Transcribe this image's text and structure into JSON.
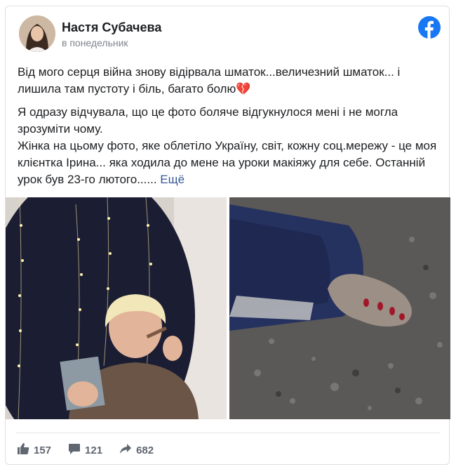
{
  "post": {
    "author": "Настя Субачева",
    "timestamp": "в понедельник",
    "paragraph1": "Від мого серця війна знову відірвала шматок...величезний шматок... і лишила там пустоту і біль, багато болю💔",
    "paragraph2_line1": "Я одразу відчувала, що це фото боляче відгукнулося мені і не могла зрозуміти чому.",
    "paragraph2_line2": "Жінка на цьому фото, яке облетіло Україну, світ, кожну соц.мережу - це моя клієнтка Ірина... яка ходила до мене на уроки макіяжу для себе. Останній урок був 23-го лютого......",
    "more_label": "Ещё",
    "likes": "157",
    "comments": "121",
    "shares": "682"
  },
  "colors": {
    "facebook_blue": "#1877f2",
    "link": "#385898",
    "muted": "#606770"
  },
  "icons": [
    "facebook-logo-icon",
    "like-icon",
    "comment-icon",
    "share-icon"
  ]
}
